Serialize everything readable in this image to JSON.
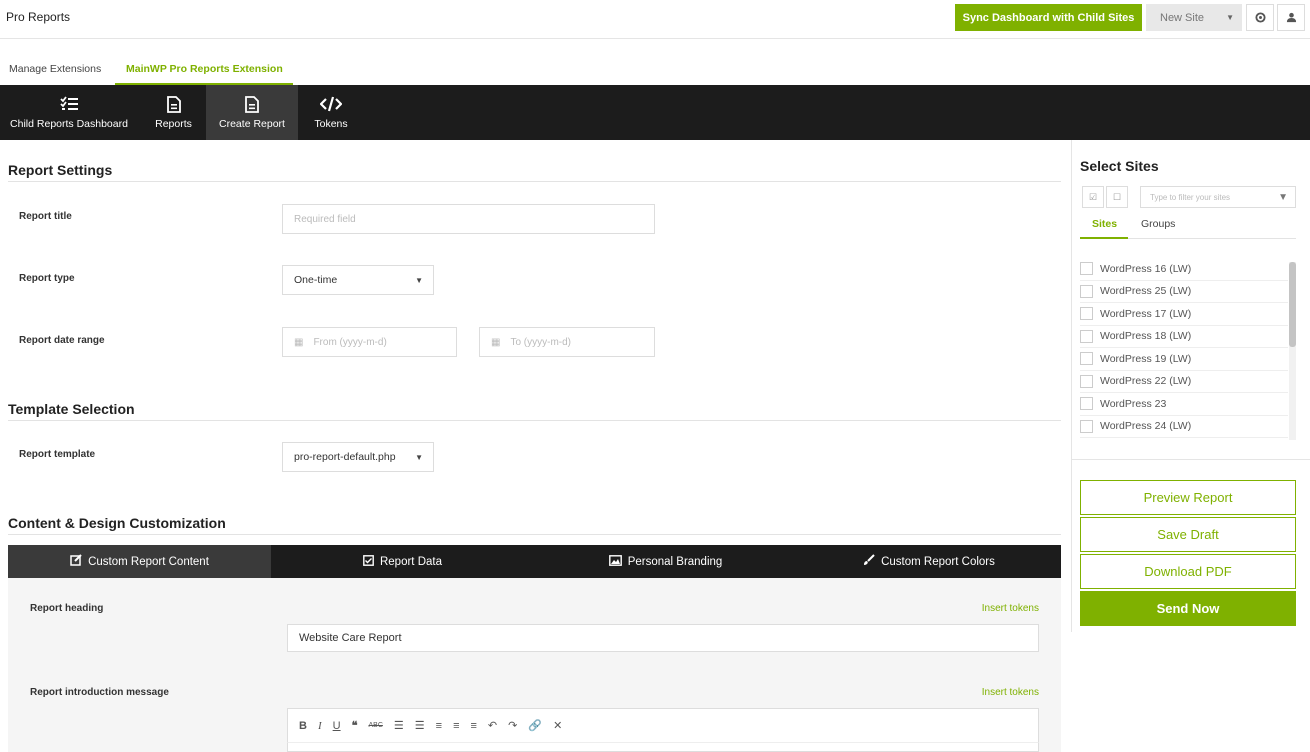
{
  "header": {
    "title": "Pro Reports",
    "sync_button": "Sync Dashboard with Child Sites",
    "new_site_button": "New Site"
  },
  "subnav": {
    "items": [
      "Manage Extensions",
      "MainWP Pro Reports Extension"
    ]
  },
  "nav": {
    "tabs": [
      "Child Reports Dashboard",
      "Reports",
      "Create Report",
      "Tokens"
    ]
  },
  "report_settings": {
    "title": "Report Settings",
    "report_title_label": "Report title",
    "report_title_placeholder": "Required field",
    "report_type_label": "Report type",
    "report_type_value": "One-time",
    "date_range_label": "Report date range",
    "from_placeholder": "From (yyyy-m-d)",
    "to_placeholder": "To (yyyy-m-d)"
  },
  "template_selection": {
    "title": "Template Selection",
    "template_label": "Report template",
    "template_value": "pro-report-default.php"
  },
  "content_design": {
    "title": "Content & Design Customization",
    "tabs": [
      "Custom Report Content",
      "Report Data",
      "Personal Branding",
      "Custom Report Colors"
    ],
    "heading_label": "Report heading",
    "heading_value": "Website Care Report",
    "intro_label": "Report introduction message",
    "insert_tokens": "Insert tokens"
  },
  "select_sites": {
    "title": "Select Sites",
    "filter_placeholder": "Type to filter your sites",
    "tabs": [
      "Sites",
      "Groups"
    ],
    "sites": [
      "WordPress 16 (LW)",
      "WordPress 25 (LW)",
      "WordPress 17 (LW)",
      "WordPress 18 (LW)",
      "WordPress 19 (LW)",
      "WordPress 22 (LW)",
      "WordPress 23",
      "WordPress 24 (LW)"
    ]
  },
  "actions": {
    "preview": "Preview Report",
    "save_draft": "Save Draft",
    "download_pdf": "Download PDF",
    "send_now": "Send Now"
  },
  "colors": {
    "accent": "#7fb100",
    "dark_nav": "#1c1c1c",
    "active_tab": "#3a3a3a"
  }
}
